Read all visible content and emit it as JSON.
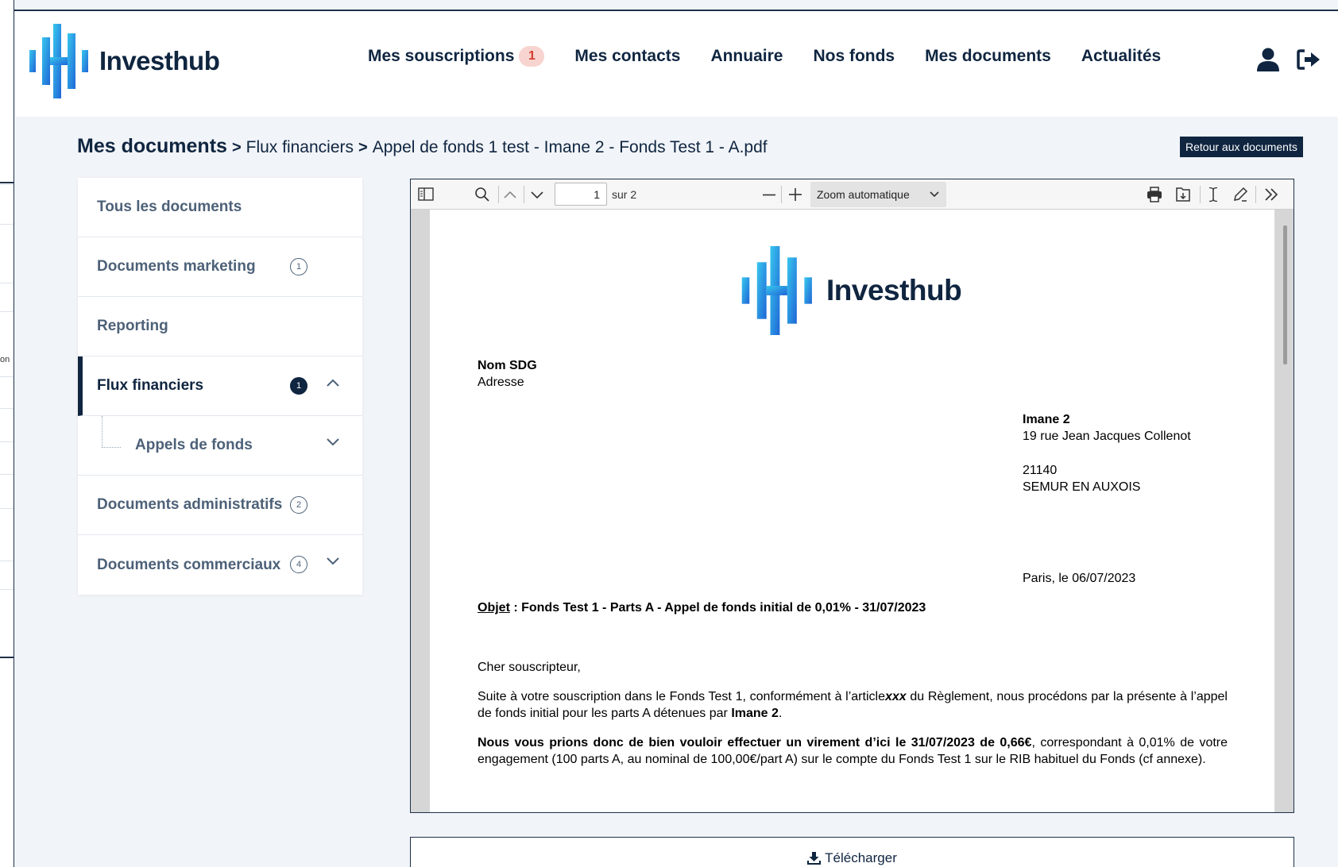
{
  "app": {
    "brand": "Investhub",
    "colors": {
      "primary": "#0f2540",
      "logo_light": "#38c7ee",
      "logo_dark": "#1f66d6",
      "badge_bg": "#f8d4d0",
      "badge_text": "#d33c2d"
    }
  },
  "nav": {
    "items": [
      {
        "label": "Mes souscriptions",
        "badge": "1"
      },
      {
        "label": "Mes contacts"
      },
      {
        "label": "Annuaire"
      },
      {
        "label": "Nos fonds"
      },
      {
        "label": "Mes documents"
      },
      {
        "label": "Actualités"
      }
    ],
    "icons": [
      "user-icon",
      "logout-icon"
    ]
  },
  "partial_left_panel": {
    "text": "on"
  },
  "breadcrumb": {
    "root": "Mes documents",
    "items": [
      "Flux financiers",
      "Appel de fonds 1 test - Imane 2 - Fonds Test 1 - A.pdf"
    ]
  },
  "back_button": "Retour aux documents",
  "sidebar": {
    "items": [
      {
        "label": "Tous les documents"
      },
      {
        "label": "Documents marketing",
        "count": "1"
      },
      {
        "label": "Reporting"
      },
      {
        "label": "Flux financiers",
        "count": "1",
        "active": true,
        "expanded": true
      },
      {
        "label": "Appels de fonds",
        "sub": true
      },
      {
        "label": "Documents administratifs",
        "count": "2"
      },
      {
        "label": "Documents commerciaux",
        "count": "4"
      }
    ]
  },
  "viewer": {
    "page_number": "1",
    "page_total": "sur 2",
    "zoom": "Zoom automatique",
    "icons": [
      "sidebar-toggle-icon",
      "search-icon",
      "chevron-up-icon",
      "chevron-down-icon",
      "minus-icon",
      "plus-icon",
      "print-icon",
      "save-icon",
      "text-cursor-icon",
      "pen-icon",
      "double-chevron-right-icon"
    ]
  },
  "document": {
    "brand": "Investhub",
    "sender_name": "Nom SDG",
    "sender_address": "Adresse",
    "recipient_name": "Imane 2",
    "recipient_street": "19 rue Jean Jacques Collenot",
    "recipient_zip": "21140",
    "recipient_city": "SEMUR EN AUXOIS",
    "place_date": "Paris, le 06/07/2023",
    "object_label": "Objet",
    "object_text": " : Fonds Test 1 - Parts A - Appel de fonds initial de 0,01% - 31/07/2023",
    "greeting": "Cher souscripteur,",
    "p1_a": "Suite à votre souscription dans le Fonds Test 1, conformément à l’article",
    "p1_article": "xxx",
    "p1_b": " du Règlement, nous procédons par la présente à l’appel de fonds initial pour les parts A détenues par ",
    "p1_name": "Imane 2",
    "p1_end": ".",
    "p2_bold": "Nous vous prions donc de bien vouloir effectuer un virement d’ici le 31/07/2023 de 0,66€",
    "p2_rest": ", correspondant à 0,01% de votre engagement (100 parts A, au nominal de 100,00€/part A) sur le compte du Fonds Test 1 sur le RIB habituel du Fonds (cf annexe)."
  },
  "download_label": "Télécharger"
}
